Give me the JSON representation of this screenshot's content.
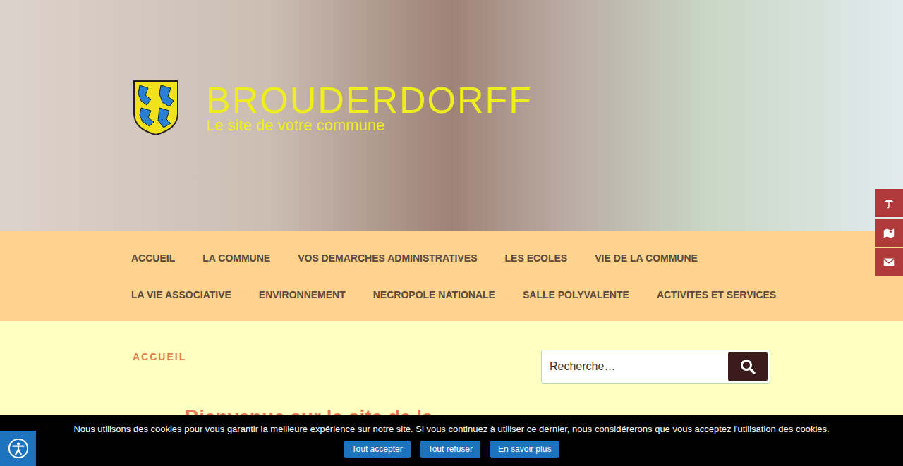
{
  "site": {
    "title": "BROUDERDORFF",
    "tagline": "Le site de votre commune"
  },
  "nav": [
    {
      "label": "ACCUEIL"
    },
    {
      "label": "LA COMMUNE"
    },
    {
      "label": "VOS DEMARCHES ADMINISTRATIVES"
    },
    {
      "label": "LES ECOLES"
    },
    {
      "label": "VIE DE LA COMMUNE"
    },
    {
      "label": "LA VIE ASSOCIATIVE"
    },
    {
      "label": "ENVIRONNEMENT"
    },
    {
      "label": "NECROPOLE NATIONALE"
    },
    {
      "label": "SALLE POLYVALENTE"
    },
    {
      "label": "ACTIVITES ET SERVICES"
    }
  ],
  "breadcrumb": "ACCUEIL",
  "search": {
    "placeholder": "Recherche…"
  },
  "heading": "Bienvenue sur le site de la",
  "cookie": {
    "message": "Nous utilisons des cookies pour vous garantir la meilleure expérience sur notre site. Si vous continuez à utiliser ce dernier, nous considérerons que vous acceptez l'utilisation des cookies.",
    "buttons": [
      "Tout accepter",
      "Tout refuser",
      "En savoir plus"
    ]
  }
}
